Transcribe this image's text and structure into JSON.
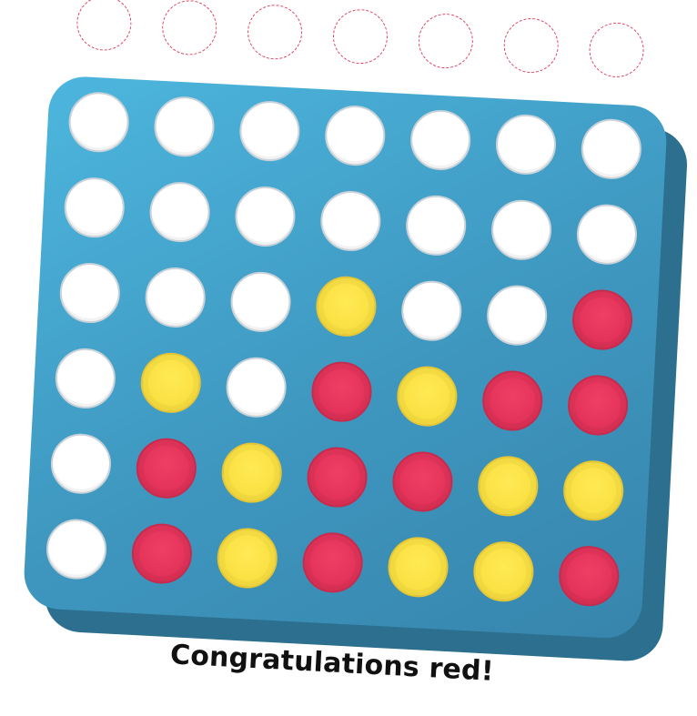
{
  "board": {
    "columns": 7,
    "rows": 6,
    "cells": [
      [
        "empty",
        "empty",
        "empty",
        "empty",
        "empty",
        "empty",
        "empty"
      ],
      [
        "empty",
        "empty",
        "empty",
        "empty",
        "empty",
        "empty",
        "empty"
      ],
      [
        "empty",
        "empty",
        "empty",
        "yellow",
        "empty",
        "empty",
        "red"
      ],
      [
        "empty",
        "yellow",
        "empty",
        "red",
        "yellow",
        "red",
        "red"
      ],
      [
        "empty",
        "red",
        "yellow",
        "red",
        "red",
        "yellow",
        "yellow"
      ],
      [
        "empty",
        "red",
        "yellow",
        "red",
        "yellow",
        "yellow",
        "red"
      ]
    ]
  },
  "colors": {
    "board": "#3e97bf",
    "board_shadow": "#2d6f8e",
    "red_disc": "#e3335a",
    "yellow_disc": "#fae143",
    "empty_hole": "#ffffff",
    "drop_slot_outline": "#e0405e"
  },
  "status": {
    "message": "Congratulations red!"
  }
}
